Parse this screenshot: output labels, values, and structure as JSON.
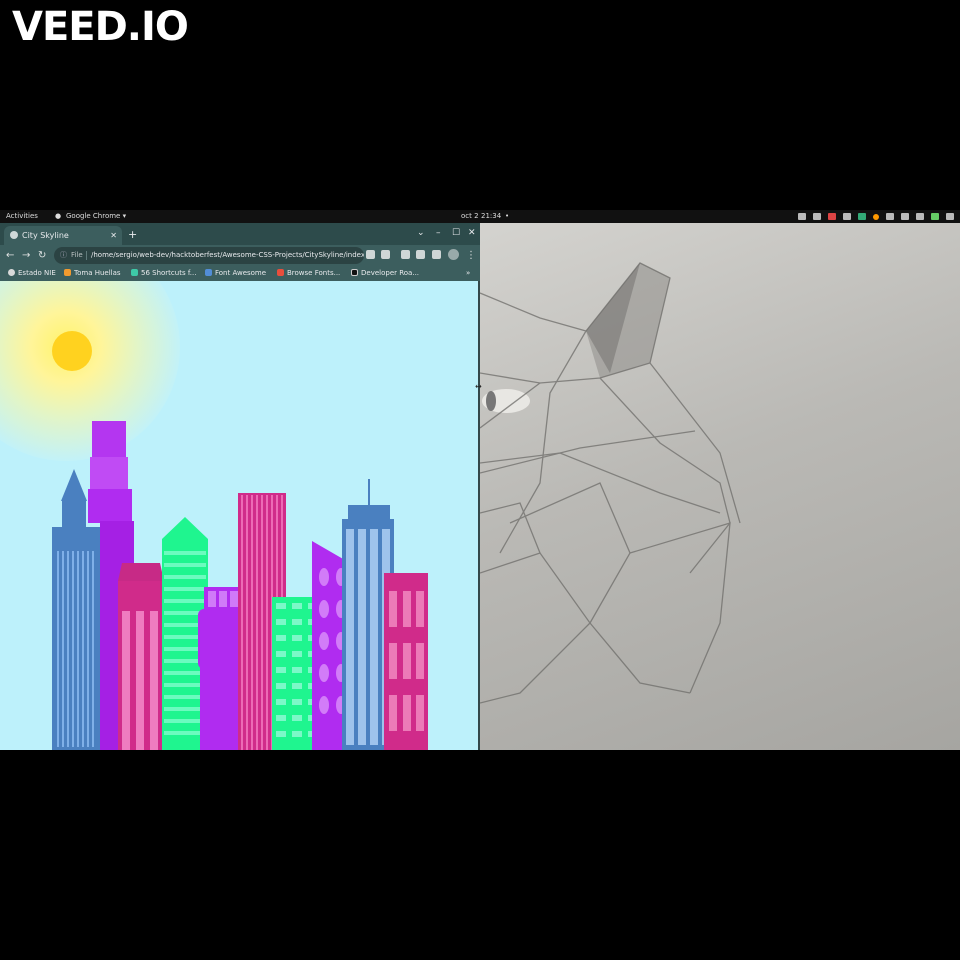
{
  "watermark": "VEED.IO",
  "topbar": {
    "activities": "Activities",
    "app_name": "Google Chrome ▾",
    "date": "oct 2",
    "time": "21:34"
  },
  "browser": {
    "tab_title": "City Skyline",
    "tab_close": "✕",
    "new_tab": "+",
    "window_controls": [
      "⌄",
      "–",
      "☐",
      "✕"
    ],
    "nav": {
      "back": "←",
      "forward": "→",
      "reload": "↻"
    },
    "address": {
      "scheme_label": "File",
      "url": "/home/sergio/web-dev/hacktoberfest/Awesome-CSS-Projects/CitySkyline/index.html"
    },
    "bookmarks": [
      {
        "label": "Estado NIE",
        "color": "#d9d9d9"
      },
      {
        "label": "Toma Huellas",
        "color": "#f29a2e"
      },
      {
        "label": "56 Shortcuts f...",
        "color": "#3ec9a7"
      },
      {
        "label": "Font Awesome",
        "color": "#528dd7"
      },
      {
        "label": "Browse Fonts...",
        "color": "#e94e3c"
      },
      {
        "label": "Developer Roa...",
        "color": "#111111"
      }
    ],
    "overflow": "»"
  },
  "colors": {
    "sky": "#bdf1fb",
    "sun": "#ffd21f",
    "blue": "#4a80c0",
    "purple": "#b02cf0",
    "pink": "#d02b8a",
    "green": "#1ff58f",
    "desktop": "#bab9b5"
  }
}
